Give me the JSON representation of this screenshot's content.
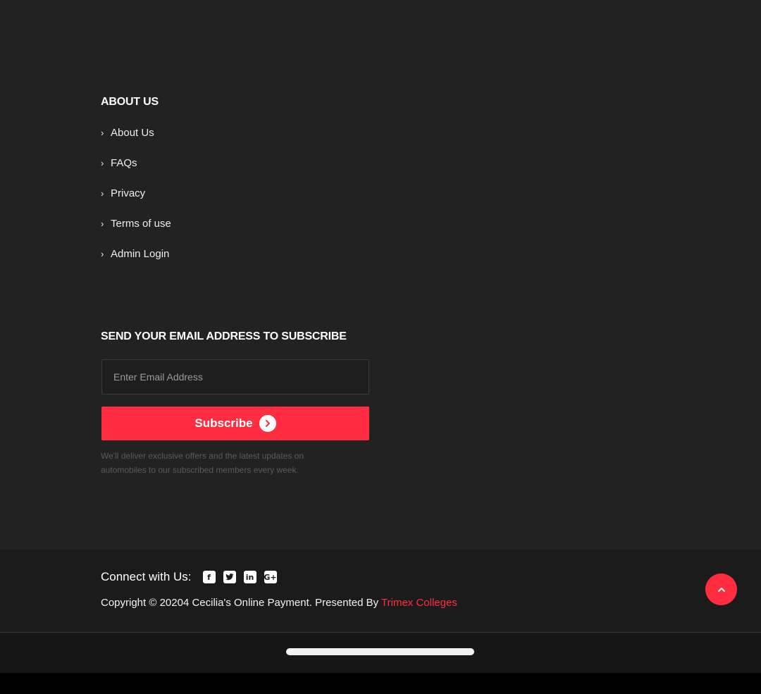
{
  "about": {
    "heading": "ABOUT US",
    "links": [
      "About Us",
      "FAQs",
      "Privacy",
      "Terms of use",
      "Admin Login"
    ]
  },
  "subscribe": {
    "heading": "SEND YOUR EMAIL ADDRESS TO SUBSCRIBE",
    "email_placeholder": "Enter Email Address",
    "email_value": "",
    "button_label": "Subscribe",
    "note": "We'll deliver exclusive offers and the latest updates on automobiles to our subscribed members every week."
  },
  "footer": {
    "connect_label": "Connect with Us:",
    "social_icons": [
      "facebook-icon",
      "twitter-icon",
      "linkedin-icon",
      "google-plus-icon"
    ],
    "copyright_text": "Copyright © 20204 Cecilia's Online Payment. Presented By ",
    "brand_link": "Trimex Colleges"
  },
  "colors": {
    "accent": "#ff2d3f",
    "background": "#222223",
    "bottom_bar": "#1b1b1c"
  }
}
